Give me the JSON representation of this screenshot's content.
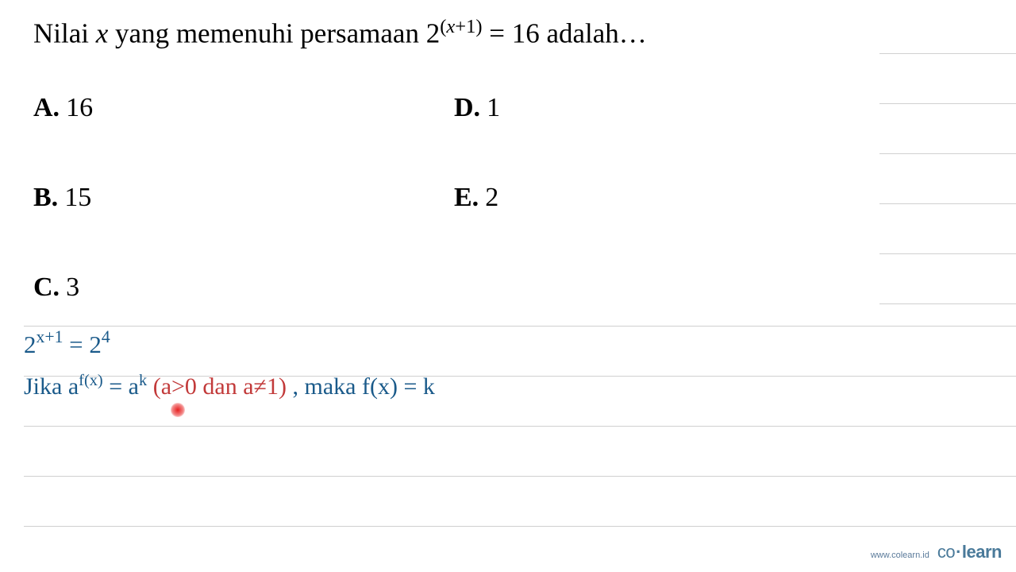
{
  "question": {
    "prefix": "Nilai ",
    "variable": "x",
    "middle": " yang memenuhi persamaan 2",
    "exponent": "(x+1)",
    "equals": " = 16 adalah…"
  },
  "options": {
    "a": {
      "label": "A.",
      "value": "16"
    },
    "b": {
      "label": "B.",
      "value": "15"
    },
    "c": {
      "label": "C.",
      "value": "3"
    },
    "d": {
      "label": "D.",
      "value": "1"
    },
    "e": {
      "label": "E.",
      "value": "2"
    }
  },
  "work": {
    "line1": {
      "base1": "2",
      "exp1": "x+1",
      "eq": " = ",
      "base2": "2",
      "exp2": "4"
    },
    "line2": {
      "jika": "Jika  ",
      "a1": "a",
      "fx": "f(x)",
      "eq": " = ",
      "a2": "a",
      "k": "k",
      "paren_open": " (",
      "cond": "a>0 dan a≠1",
      "paren_close": ") ",
      "comma": ",  ",
      "maka": "maka f(x) = k"
    }
  },
  "footer": {
    "url": "www.colearn.id",
    "logo_co": "co",
    "logo_dot": "·",
    "logo_learn": "learn"
  }
}
